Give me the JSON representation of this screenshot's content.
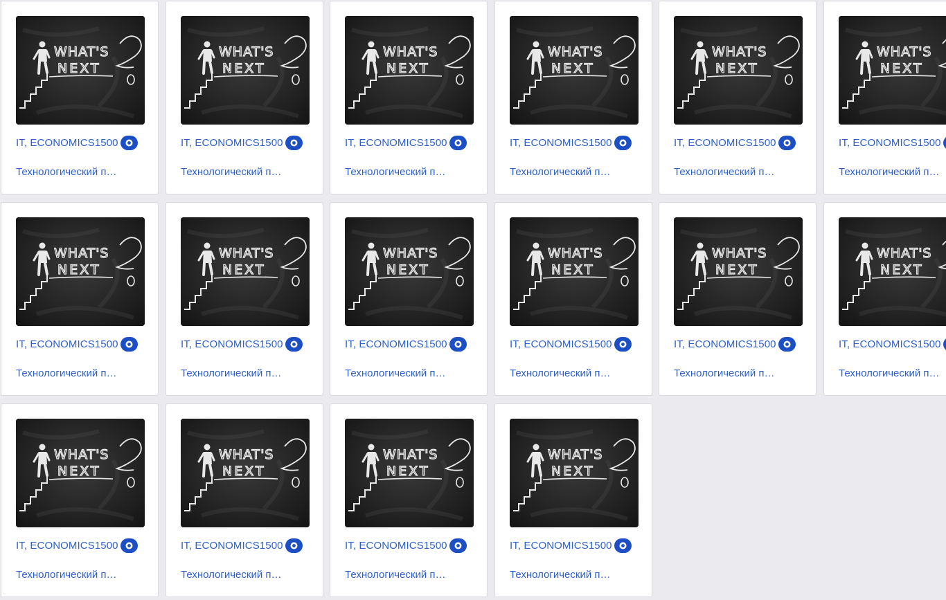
{
  "cards": [
    {
      "tags": "IT, ECONOMICS",
      "views": "1500",
      "title": "Технологический предприниматель",
      "view_icon": "eye-icon",
      "image": "whats-next-chalkboard"
    },
    {
      "tags": "IT, ECONOMICS",
      "views": "1500",
      "title": "Технологический предприниматель",
      "view_icon": "eye-icon",
      "image": "whats-next-chalkboard"
    },
    {
      "tags": "IT, ECONOMICS",
      "views": "1500",
      "title": "Технологический предприниматель",
      "view_icon": "eye-icon",
      "image": "whats-next-chalkboard"
    },
    {
      "tags": "IT, ECONOMICS",
      "views": "1500",
      "title": "Технологический предприниматель",
      "view_icon": "eye-icon",
      "image": "whats-next-chalkboard"
    },
    {
      "tags": "IT, ECONOMICS",
      "views": "1500",
      "title": "Технологический предприниматель",
      "view_icon": "eye-icon",
      "image": "whats-next-chalkboard"
    },
    {
      "tags": "IT, ECONOMICS",
      "views": "1500",
      "title": "Технологический предприниматель",
      "view_icon": "eye-icon",
      "image": "whats-next-chalkboard"
    },
    {
      "tags": "IT, ECONOMICS",
      "views": "1500",
      "title": "Технологический предприниматель",
      "view_icon": "eye-icon",
      "image": "whats-next-chalkboard"
    },
    {
      "tags": "IT, ECONOMICS",
      "views": "1500",
      "title": "Технологический предприниматель",
      "view_icon": "eye-icon",
      "image": "whats-next-chalkboard"
    },
    {
      "tags": "IT, ECONOMICS",
      "views": "1500",
      "title": "Технологический предприниматель",
      "view_icon": "eye-icon",
      "image": "whats-next-chalkboard"
    },
    {
      "tags": "IT, ECONOMICS",
      "views": "1500",
      "title": "Технологический предприниматель",
      "view_icon": "eye-icon",
      "image": "whats-next-chalkboard"
    },
    {
      "tags": "IT, ECONOMICS",
      "views": "1500",
      "title": "Технологический предприниматель",
      "view_icon": "eye-icon",
      "image": "whats-next-chalkboard"
    },
    {
      "tags": "IT, ECONOMICS",
      "views": "1500",
      "title": "Технологический предприниматель",
      "view_icon": "eye-icon",
      "image": "whats-next-chalkboard"
    },
    {
      "tags": "IT, ECONOMICS",
      "views": "1500",
      "title": "Технологический предприниматель",
      "view_icon": "eye-icon",
      "image": "whats-next-chalkboard"
    },
    {
      "tags": "IT, ECONOMICS",
      "views": "1500",
      "title": "Технологический предприниматель",
      "view_icon": "eye-icon",
      "image": "whats-next-chalkboard"
    },
    {
      "tags": "IT, ECONOMICS",
      "views": "1500",
      "title": "Технологический предприниматель",
      "view_icon": "eye-icon",
      "image": "whats-next-chalkboard"
    },
    {
      "tags": "IT, ECONOMICS",
      "views": "1500",
      "title": "Технологический предприниматель",
      "view_icon": "eye-icon",
      "image": "whats-next-chalkboard"
    }
  ],
  "image_text": {
    "line1": "WHAT'S",
    "line2": "NEXT"
  },
  "colors": {
    "background": "#ebebef",
    "card": "#ffffff",
    "link": "#2c5fcf",
    "eye_badge": "#1d4fc4",
    "chalkboard": "#2a2a2a",
    "chalk": "#e8e8e8"
  }
}
